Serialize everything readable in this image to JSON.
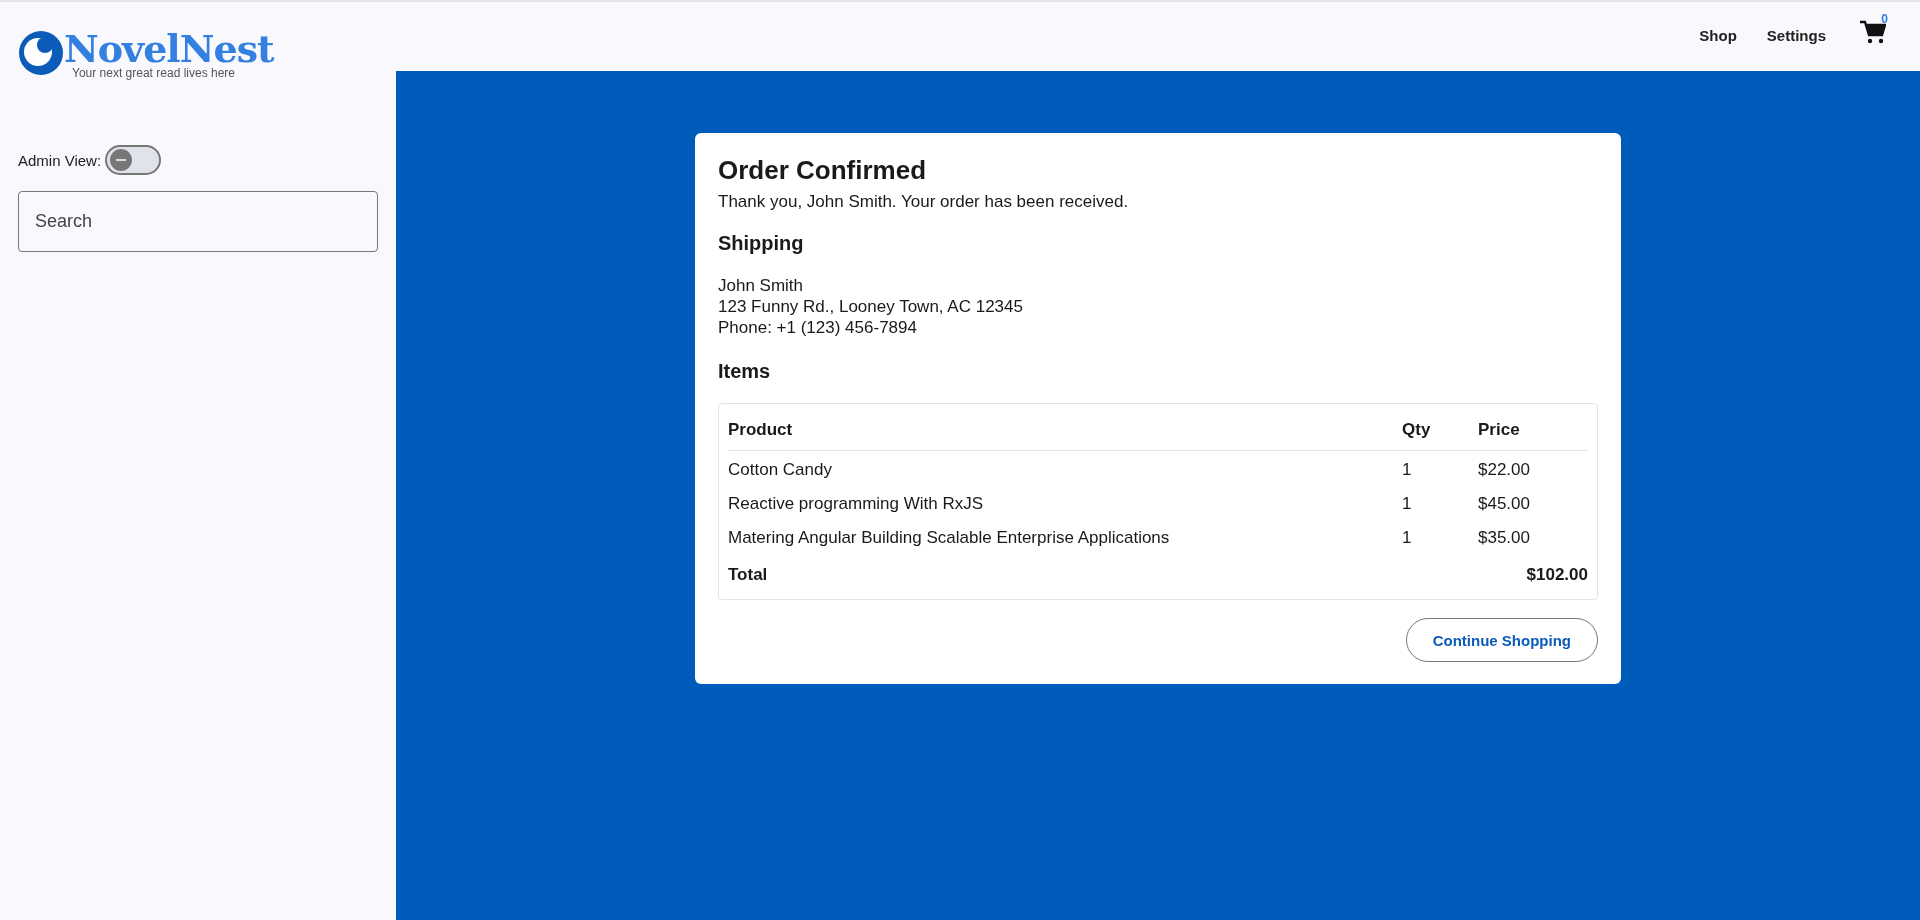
{
  "header": {
    "logo": {
      "title": "NovelNest",
      "tagline": "Your next great read lives here"
    },
    "nav": [
      {
        "label": "Shop"
      },
      {
        "label": "Settings"
      }
    ],
    "cart": {
      "count": "0"
    }
  },
  "sidebar": {
    "admin_view": {
      "label": "Admin View:",
      "on": false
    },
    "search": {
      "placeholder": "Search"
    }
  },
  "order": {
    "title": "Order Confirmed",
    "message": "Thank you, John Smith. Your order has been received.",
    "shipping": {
      "heading": "Shipping",
      "lines": [
        "John Smith",
        "123 Funny Rd., Looney Town, AC 12345",
        "Phone: +1 (123) 456-7894"
      ]
    },
    "items": {
      "heading": "Items",
      "columns": [
        "Product",
        "Qty",
        "Price"
      ],
      "rows": [
        [
          "Cotton Candy",
          "1",
          "$22.00"
        ],
        [
          "Reactive programming With RxJS",
          "1",
          "$45.00"
        ],
        [
          "Matering Angular Building Scalable Enterprise Applications",
          "1",
          "$35.00"
        ]
      ],
      "total": {
        "label": "Total",
        "value": "$102.00"
      }
    },
    "button": "Continue Shopping"
  }
}
